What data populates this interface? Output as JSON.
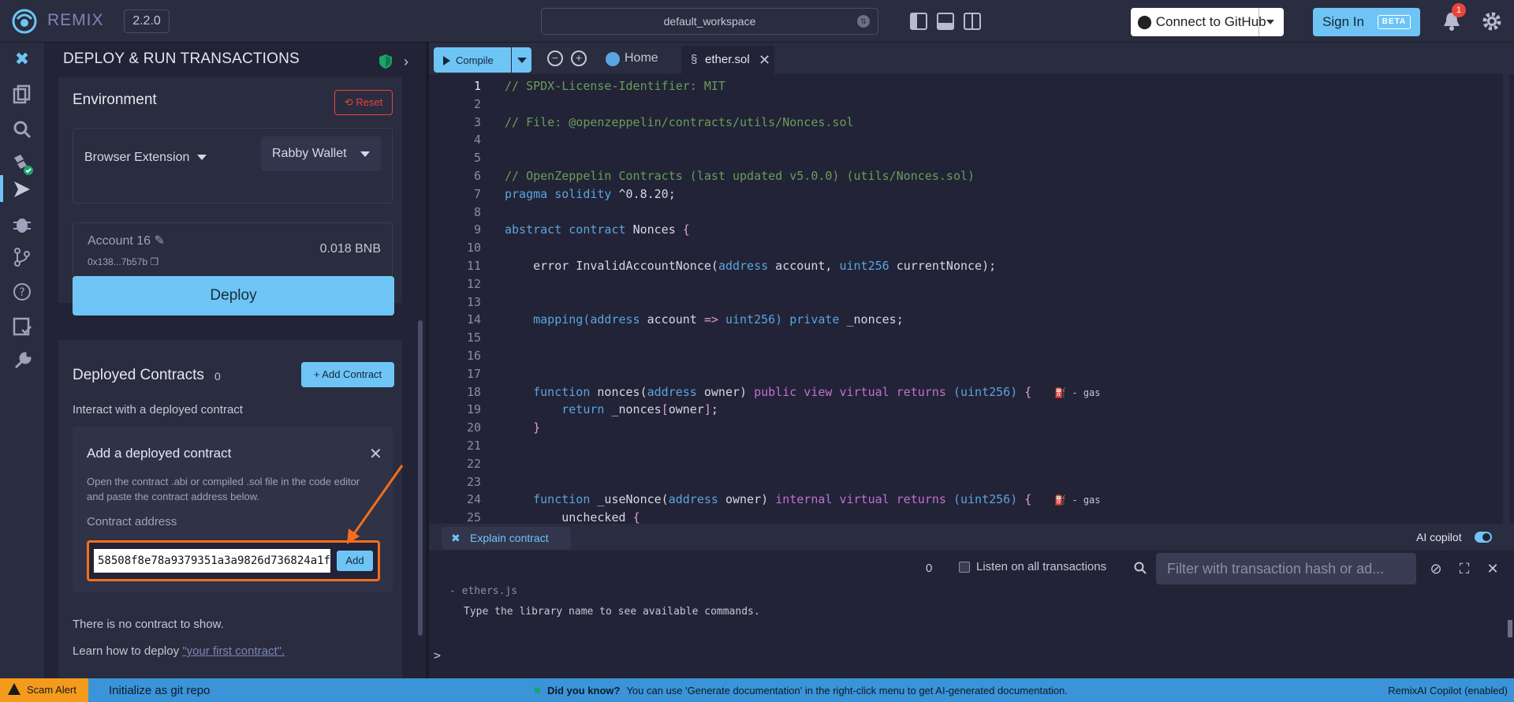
{
  "topbar": {
    "brand": "REMIX",
    "version": "2.2.0",
    "workspace": "default_workspace",
    "github_label": "Connect to GitHub",
    "signin_label": "Sign In",
    "signin_badge": "BETA",
    "notification_count": "1"
  },
  "panel": {
    "title": "DEPLOY & RUN TRANSACTIONS",
    "environment": {
      "label": "Environment",
      "reset_label": "Reset",
      "provider": "Browser Extension",
      "wallet": "Rabby Wallet",
      "account_name": "Account 16",
      "account_address": "0x138...7b57b",
      "balance": "0.018 BNB"
    },
    "deploy_label": "Deploy",
    "deployed": {
      "label": "Deployed Contracts",
      "count": "0",
      "add_button": "+ Add Contract",
      "interact_text": "Interact with a deployed contract",
      "add_panel": {
        "title": "Add a deployed contract",
        "description": "Open the contract .abi or compiled .sol file in the code editor and paste the contract address below.",
        "address_label": "Contract address",
        "address_value": "58508f8e78a9379351a3a9826d736824a1f",
        "add_label": "Add"
      },
      "empty_text": "There is no contract to show.",
      "learn_prefix": "Learn how to deploy ",
      "learn_link": "\"your first contract\"."
    }
  },
  "editor": {
    "compile_label": "Compile",
    "home_tab": "Home",
    "file_tab": "ether.sol",
    "lines": [
      {
        "n": "1",
        "parts": [
          {
            "c": "cm",
            "t": "// SPDX-License-Identifier: MIT"
          }
        ]
      },
      {
        "n": "2",
        "parts": []
      },
      {
        "n": "3",
        "parts": [
          {
            "c": "cm",
            "t": "// File: @openzeppelin/contracts/utils/Nonces.sol"
          }
        ]
      },
      {
        "n": "4",
        "parts": []
      },
      {
        "n": "5",
        "parts": []
      },
      {
        "n": "6",
        "parts": [
          {
            "c": "cm",
            "t": "// OpenZeppelin Contracts (last updated v5.0.0) (utils/Nonces.sol)"
          }
        ]
      },
      {
        "n": "7",
        "parts": [
          {
            "c": "ty",
            "t": "pragma solidity "
          },
          {
            "c": "fn",
            "t": "^0.8.20;"
          }
        ]
      },
      {
        "n": "8",
        "parts": []
      },
      {
        "n": "9",
        "parts": [
          {
            "c": "ty",
            "t": "abstract contract "
          },
          {
            "c": "fn",
            "t": "Nonces "
          },
          {
            "c": "br",
            "t": "{"
          }
        ]
      },
      {
        "n": "10",
        "parts": []
      },
      {
        "n": "11",
        "parts": [
          {
            "c": "fn",
            "t": "    error InvalidAccountNonce("
          },
          {
            "c": "ty",
            "t": "address"
          },
          {
            "c": "fn",
            "t": " account, "
          },
          {
            "c": "ty",
            "t": "uint256"
          },
          {
            "c": "fn",
            "t": " currentNonce);"
          }
        ]
      },
      {
        "n": "12",
        "parts": []
      },
      {
        "n": "13",
        "parts": []
      },
      {
        "n": "14",
        "parts": [
          {
            "c": "ty",
            "t": "    mapping("
          },
          {
            "c": "ty",
            "t": "address"
          },
          {
            "c": "fn",
            "t": " account "
          },
          {
            "c": "br",
            "t": "=>"
          },
          {
            "c": "ty",
            "t": " uint256) private"
          },
          {
            "c": "fn",
            "t": " _nonces;"
          }
        ]
      },
      {
        "n": "15",
        "parts": []
      },
      {
        "n": "16",
        "parts": []
      },
      {
        "n": "17",
        "parts": []
      },
      {
        "n": "18",
        "parts": [
          {
            "c": "ty",
            "t": "    function "
          },
          {
            "c": "fn",
            "t": "nonces("
          },
          {
            "c": "ty",
            "t": "address"
          },
          {
            "c": "fn",
            "t": " owner) "
          },
          {
            "c": "kw",
            "t": "public view virtual returns "
          },
          {
            "c": "ty",
            "t": "(uint256) "
          },
          {
            "c": "br",
            "t": "{"
          },
          {
            "c": "gas",
            "t": "    ⛽ - gas"
          }
        ]
      },
      {
        "n": "19",
        "parts": [
          {
            "c": "ty",
            "t": "        return "
          },
          {
            "c": "fn",
            "t": "_nonces"
          },
          {
            "c": "br",
            "t": "["
          },
          {
            "c": "fn",
            "t": "owner"
          },
          {
            "c": "br",
            "t": "]"
          },
          {
            "c": "fn",
            "t": ";"
          }
        ]
      },
      {
        "n": "20",
        "parts": [
          {
            "c": "br",
            "t": "    }"
          }
        ]
      },
      {
        "n": "21",
        "parts": []
      },
      {
        "n": "22",
        "parts": []
      },
      {
        "n": "23",
        "parts": []
      },
      {
        "n": "24",
        "parts": [
          {
            "c": "ty",
            "t": "    function "
          },
          {
            "c": "fn",
            "t": "_useNonce("
          },
          {
            "c": "ty",
            "t": "address"
          },
          {
            "c": "fn",
            "t": " owner) "
          },
          {
            "c": "kw",
            "t": "internal virtual returns "
          },
          {
            "c": "ty",
            "t": "(uint256) "
          },
          {
            "c": "br",
            "t": "{"
          },
          {
            "c": "gas",
            "t": "    ⛽ - gas"
          }
        ]
      },
      {
        "n": "25",
        "parts": [
          {
            "c": "fn",
            "t": "        unchecked "
          },
          {
            "c": "br",
            "t": "{"
          }
        ]
      }
    ]
  },
  "terminal": {
    "explain_label": "Explain contract",
    "ai_copilot_label": "AI copilot",
    "tx_count": "0",
    "listen_label": "Listen on all transactions",
    "filter_placeholder": "Filter with transaction hash or ad...",
    "line1": "- ethers.js",
    "line2": "Type the library name to see available commands.",
    "prompt": ">"
  },
  "statusbar": {
    "scam_label": "Scam Alert",
    "git_label": "Initialize as git repo",
    "dyk_title": "Did you know?",
    "dyk_text": "You can use 'Generate documentation' in the right-click menu to get AI-generated documentation.",
    "copilot_status": "RemixAI Copilot (enabled)"
  }
}
